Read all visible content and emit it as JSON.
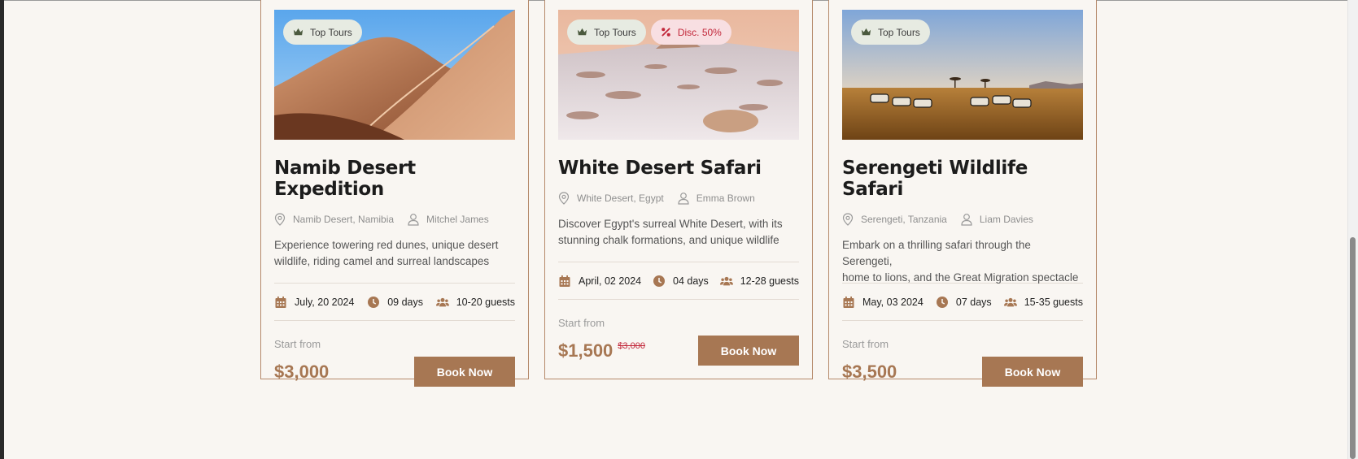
{
  "colors": {
    "accent": "#a77753",
    "border": "#b5896a",
    "discount": "#c2273a",
    "background": "#f9f6f2"
  },
  "labels": {
    "start_from": "Start from",
    "book_now": "Book Now"
  },
  "tours": [
    {
      "badges": [
        {
          "type": "top",
          "label": "Top Tours",
          "icon": "crown-icon"
        }
      ],
      "title": "Namib Desert Expedition",
      "location": "Namib Desert, Namibia",
      "guide": "Mitchel James",
      "description_line1": "Experience towering red dunes, unique desert",
      "description_line2": "wildlife, riding camel and surreal landscapes",
      "date": "July, 20 2024",
      "duration": "09 days",
      "guests": "10-20 guests",
      "price": "$3,000",
      "old_price": ""
    },
    {
      "badges": [
        {
          "type": "top",
          "label": "Top Tours",
          "icon": "crown-icon"
        },
        {
          "type": "disc",
          "label": "Disc. 50%",
          "icon": "percent-icon"
        }
      ],
      "title": "White Desert Safari",
      "location": "White Desert, Egypt",
      "guide": "Emma Brown",
      "description_line1": "Discover Egypt's surreal White Desert, with its",
      "description_line2": "stunning chalk formations, and unique wildlife",
      "date": "April, 02 2024",
      "duration": "04 days",
      "guests": "12-28 guests",
      "price": "$1,500",
      "old_price": "$3,000"
    },
    {
      "badges": [
        {
          "type": "top",
          "label": "Top Tours",
          "icon": "crown-icon"
        }
      ],
      "title": "Serengeti Wildlife Safari",
      "location": "Serengeti, Tanzania",
      "guide": "Liam Davies",
      "description_line1": "Embark on a thrilling safari through the Serengeti,",
      "description_line2": "home to lions, and the Great Migration spectacle",
      "date": "May, 03 2024",
      "duration": "07 days",
      "guests": "15-35 guests",
      "price": "$3,500",
      "old_price": ""
    }
  ]
}
